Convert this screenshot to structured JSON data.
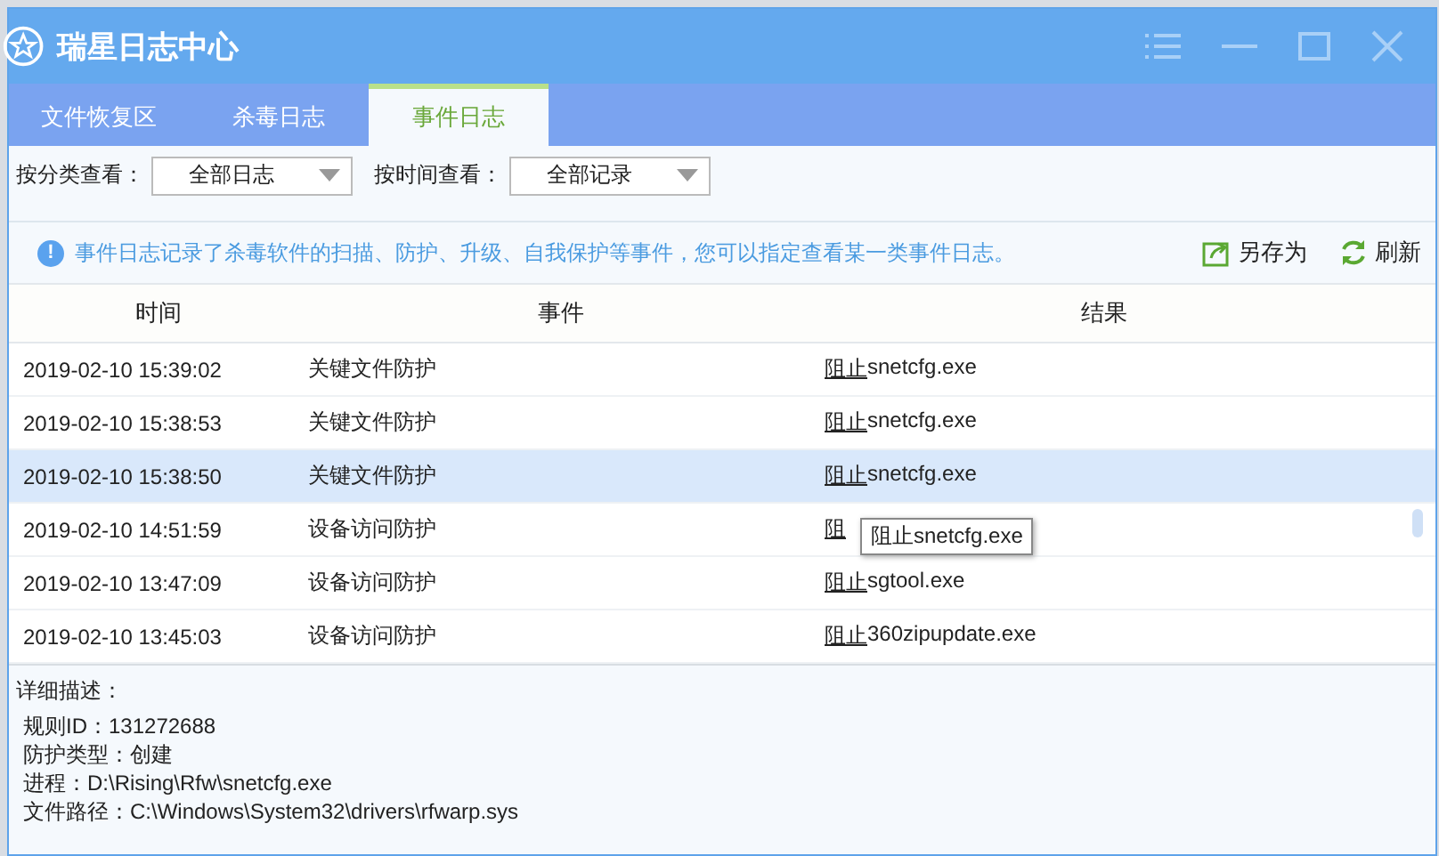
{
  "window": {
    "title": "瑞星日志中心"
  },
  "tabs": [
    {
      "label": "文件恢复区",
      "selected": false
    },
    {
      "label": "杀毒日志",
      "selected": false
    },
    {
      "label": "事件日志",
      "selected": true
    }
  ],
  "filters": [
    {
      "label": "按分类查看：",
      "value": "全部日志"
    },
    {
      "label": "按时间查看：",
      "value": "全部记录"
    }
  ],
  "info": {
    "icon": "!",
    "text": "事件日志记录了杀毒软件的扫描、防护、升级、自我保护等事件，您可以指定查看某一类事件日志。"
  },
  "actions": [
    {
      "kind": "export",
      "label": "另存为"
    },
    {
      "kind": "refresh",
      "label": "刷新"
    }
  ],
  "table": {
    "columns": [
      "时间",
      "事件",
      "结果"
    ],
    "rows": [
      {
        "time": "2019-02-10 15:39:02",
        "event": "关键文件防护",
        "action": "阻止",
        "target": "snetcfg.exe",
        "selected": false
      },
      {
        "time": "2019-02-10 15:38:53",
        "event": "关键文件防护",
        "action": "阻止",
        "target": "snetcfg.exe",
        "selected": false
      },
      {
        "time": "2019-02-10 15:38:50",
        "event": "关键文件防护",
        "action": "阻止",
        "target": "snetcfg.exe",
        "selected": true
      },
      {
        "time": "2019-02-10 14:51:59",
        "event": "设备访问防护",
        "action": "阻",
        "selected": false
      },
      {
        "time": "2019-02-10 13:47:09",
        "event": "设备访问防护",
        "action": "阻止",
        "target": "sgtool.exe",
        "selected": false
      },
      {
        "time": "2019-02-10 13:45:03",
        "event": "设备访问防护",
        "action": "阻止",
        "target": "360zipupdate.exe",
        "selected": false
      }
    ]
  },
  "tooltip": {
    "text": "阻止snetcfg.exe"
  },
  "details": {
    "title": "详细描述：",
    "lines": [
      "规则ID：131272688",
      "防护类型：创建",
      "进程：D:\\Rising\\Rfw\\snetcfg.exe",
      "文件路径：C:\\Windows\\System32\\drivers\\rfwarp.sys"
    ]
  }
}
